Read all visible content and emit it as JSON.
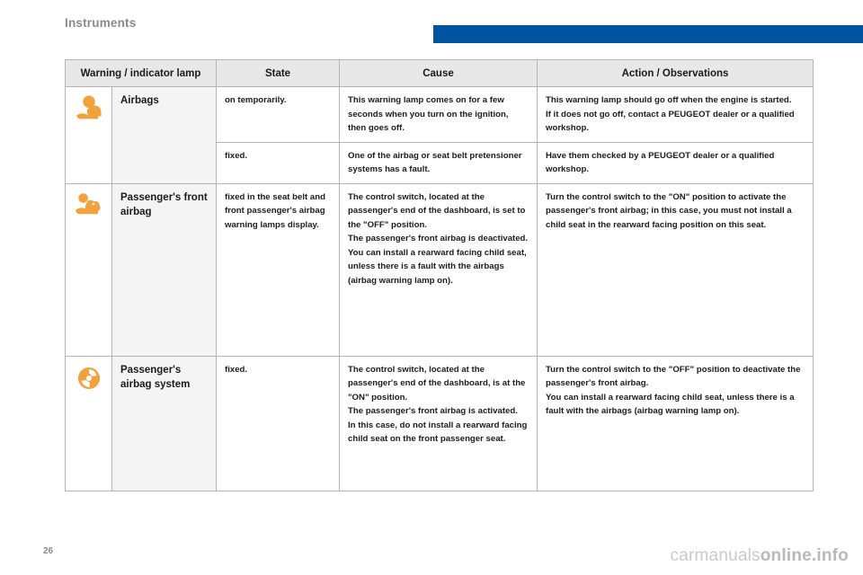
{
  "header": {
    "section_title": "Instruments",
    "accent_color": "#00539f"
  },
  "table": {
    "columns": [
      {
        "id": "lamp",
        "label": "Warning / indicator lamp"
      },
      {
        "id": "state",
        "label": "State"
      },
      {
        "id": "cause",
        "label": "Cause"
      },
      {
        "id": "action",
        "label": "Action / Observations"
      }
    ],
    "rows": [
      {
        "icon": "airbag-warning-icon",
        "icon_color": "#f2a13c",
        "name": "Airbags",
        "state": "on temporarily.",
        "cause": [
          "This warning lamp comes on for a few seconds when you turn on the ignition, then goes off."
        ],
        "action": [
          "This warning lamp should go off when the engine is started.",
          "If it does not go off, contact a PEUGEOT dealer or a qualified workshop."
        ]
      },
      {
        "icon": null,
        "icon_color": "#f2a13c",
        "name": "",
        "state": "fixed.",
        "cause": [
          "One of the airbag or seat belt pretensioner systems has a fault."
        ],
        "action": [
          "Have them checked by a PEUGEOT dealer or a qualified workshop."
        ]
      },
      {
        "icon": "passenger-front-airbag-off-icon",
        "icon_color": "#f2a13c",
        "name": "Passenger's front airbag",
        "state": "fixed in the seat belt and front passenger's airbag warning lamps display.",
        "cause": [
          "The control switch, located at the passenger's end of the dashboard, is set to the \"OFF\" position.",
          "The passenger's front airbag is deactivated.",
          "You can install a rearward facing child seat, unless there is a fault with the airbags (airbag warning lamp on)."
        ],
        "action": [
          "Turn the control switch to the \"ON\" position to activate the passenger's front airbag; in this case, you must not install a child seat in the rearward facing position on this seat."
        ]
      },
      {
        "icon": "passenger-airbag-system-icon",
        "icon_color": "#f2a13c",
        "name": "Passenger's airbag system",
        "state": "fixed.",
        "cause": [
          "The control switch, located at the passenger's end of the dashboard, is at the \"ON\" position.",
          "The passenger's front airbag is activated.",
          "In this case, do not install a rearward facing child seat on the front passenger seat."
        ],
        "action": [
          "Turn the control switch to the \"OFF\" position to deactivate the passenger's front airbag.",
          "You can install a rearward facing child seat, unless there is a fault with the airbags (airbag warning lamp on)."
        ]
      }
    ]
  },
  "footer": {
    "page_number": "26",
    "watermark_prefix": "carmanuals",
    "watermark_suffix": "online.info"
  }
}
